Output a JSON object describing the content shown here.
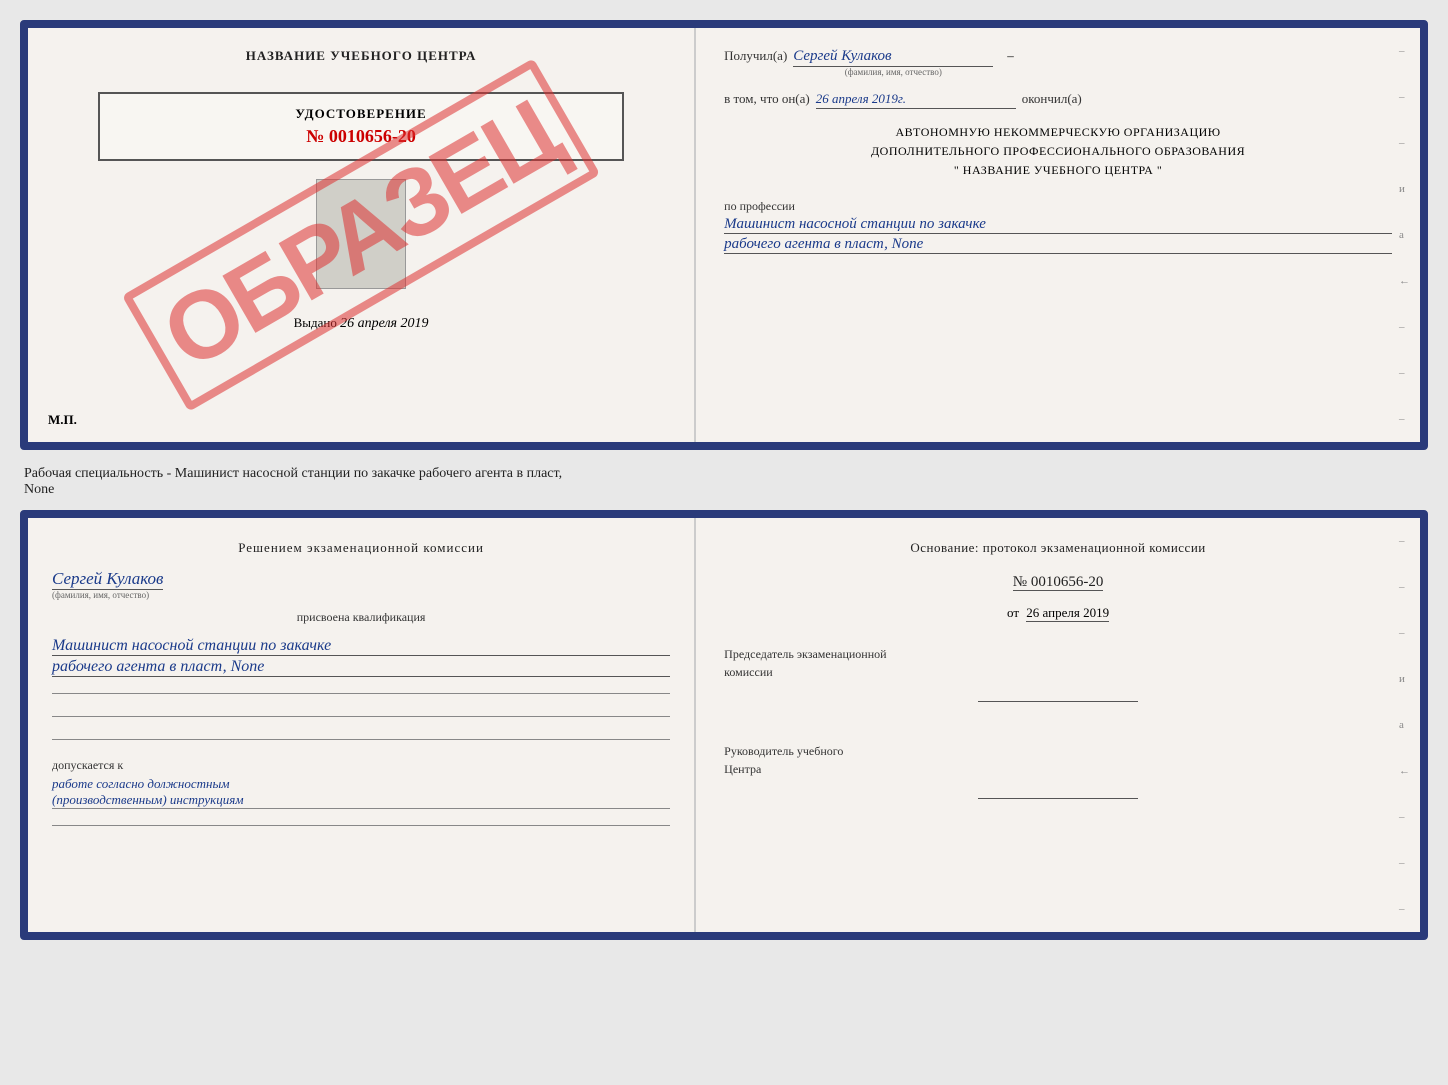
{
  "topDoc": {
    "left": {
      "title": "НАЗВАНИЕ УЧЕБНОГО ЦЕНТРА",
      "obrazec": "ОБРАЗЕЦ",
      "certTitle": "УДОСТОВЕРЕНИЕ",
      "certNumber": "№ 0010656-20",
      "vydanoLabel": "Выдано",
      "vydanoDate": "26 апреля 2019",
      "mp": "М.П."
    },
    "right": {
      "poluchilLabel": "Получил(а)",
      "poluchilValue": "Сергей Кулаков",
      "familiyaText": "(фамилия, имя, отчество)",
      "vtomLabel": "в том, что он(а)",
      "vtomValue": "26 апреля 2019г.",
      "okoncilLabel": "окончил(а)",
      "orgBlock1": "АВТОНОМНУЮ НЕКОММЕРЧЕСКУЮ ОРГАНИЗАЦИЮ",
      "orgBlock2": "ДОПОЛНИТЕЛЬНОГО ПРОФЕССИОНАЛЬНОГО ОБРАЗОВАНИЯ",
      "orgBlock3": "\"  НАЗВАНИЕ УЧЕБНОГО ЦЕНТРА  \"",
      "professionLabel": "по профессии",
      "professionLine1": "Машинист насосной станции по закачке",
      "professionLine2": "рабочего агента в пласт, None",
      "dashes": [
        "-",
        "-",
        "-",
        "и",
        "а",
        "←",
        "-",
        "-",
        "-"
      ]
    }
  },
  "middleText": "Рабочая специальность - Машинист насосной станции по закачке рабочего агента в пласт,\nNone",
  "bottomDoc": {
    "left": {
      "komissiaText": "Решением  экзаменационной  комиссии",
      "nameValue": "Сергей Кулаков",
      "nameSubtext": "(фамилия, имя, отчество)",
      "prisvoenaLabel": "присвоена квалификация",
      "kvalLine1": "Машинист насосной станции по закачке",
      "kvalLine2": "рабочего агента в пласт, None",
      "separators": [
        "___",
        "___",
        "___"
      ],
      "dopuskaetsyaLabel": "допускается к",
      "dopuskaetsyaValue": "работе согласно должностным\n(производственным) инструкциям",
      "separatorBottom": "___"
    },
    "right": {
      "osnovTitle": "Основание: протокол экзаменационной  комиссии",
      "numberLabel": "№ 0010656-20",
      "otLabel": "от",
      "otDate": "26 апреля 2019",
      "predsedatelTitle": "Председатель экзаменационной\nкомиссии",
      "rukovoditelTitle": "Руководитель учебного\nЦентра",
      "dashes": [
        "-",
        "-",
        "-",
        "и",
        "а",
        "←",
        "-",
        "-",
        "-"
      ]
    }
  }
}
